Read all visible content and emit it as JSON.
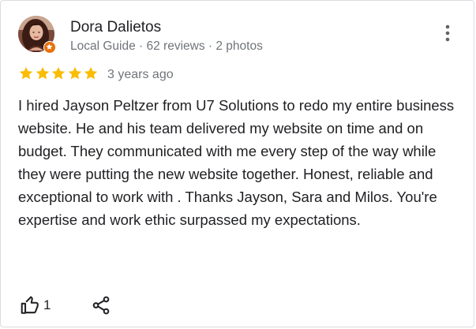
{
  "review": {
    "reviewer": {
      "name": "Dora Dalietos",
      "meta": "Local Guide · 62 reviews · 2 photos",
      "avatar_icon": "user-photo-icon",
      "badge_icon": "local-guide-star-icon"
    },
    "rating": 5,
    "rating_max": 5,
    "date": "3 years ago",
    "text": "I hired Jayson Peltzer from U7 Solutions to redo my entire business website. He and his team delivered my website on time and on budget. They communicated with me every step of the way while they were putting the new website together. Honest, reliable and exceptional to work with . Thanks Jayson, Sara and Milos. You're expertise and work ethic surpassed my expectations.",
    "likes": "1",
    "icons": {
      "more": "more-vert-icon",
      "like": "thumb-up-icon",
      "share": "share-icon"
    },
    "colors": {
      "star": "#fbbc04",
      "badge": "#e8710a",
      "name": "#202124",
      "meta": "#70757a"
    }
  }
}
